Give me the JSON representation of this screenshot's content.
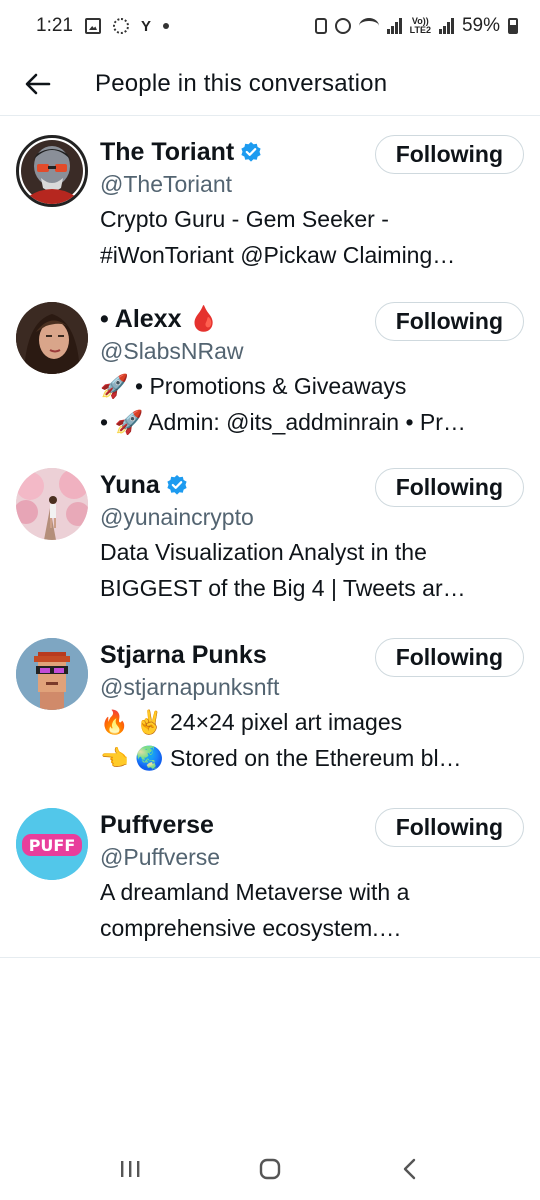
{
  "status_bar": {
    "time": "1:21",
    "battery_percent": "59%",
    "volte_label": "Vo))",
    "lte_label": "LTE2"
  },
  "header": {
    "title": "People in this conversation",
    "back_icon": "arrow-left-icon"
  },
  "colors": {
    "verified_blue": "#1d9bf0",
    "handle_gray": "#536471",
    "text_dark": "#0f1419",
    "border": "#cfd9de"
  },
  "users": [
    {
      "name": "The Toriant",
      "verified": true,
      "handle": "@TheToriant",
      "bio_line1": "Crypto Guru - Gem Seeker -",
      "bio_line2": "#iWonToriant @Pickaw  Claiming…",
      "follow_label": "Following"
    },
    {
      "name": "• Alexx 🩸",
      "verified": false,
      "handle": "@SlabsNRaw",
      "bio_line1": "🚀 • Promotions & Giveaways",
      "bio_line2": "• 🚀 Admin: @its_addminrain • Pr…",
      "follow_label": "Following"
    },
    {
      "name": "Yuna",
      "verified": true,
      "handle": "@yunaincrypto",
      "bio_line1": "Data Visualization Analyst in the",
      "bio_line2": "BIGGEST of the Big 4 | Tweets ar…",
      "follow_label": "Following"
    },
    {
      "name": "Stjarna Punks",
      "verified": false,
      "handle": "@stjarnapunksnft",
      "bio_line1": "🔥 ✌️ 24×24 pixel art images",
      "bio_line2": "👈 🌏 Stored on the Ethereum bl…",
      "follow_label": "Following"
    },
    {
      "name": "Puffverse",
      "verified": false,
      "handle": "@Puffverse",
      "bio_line1": "A dreamland Metaverse with a",
      "bio_line2": "comprehensive ecosystem.…",
      "follow_label": "Following"
    }
  ],
  "avatar_logo_text": "PUFF",
  "nav": {
    "recent_icon": "recent-apps-icon",
    "home_icon": "home-icon",
    "back_icon": "back-icon"
  }
}
